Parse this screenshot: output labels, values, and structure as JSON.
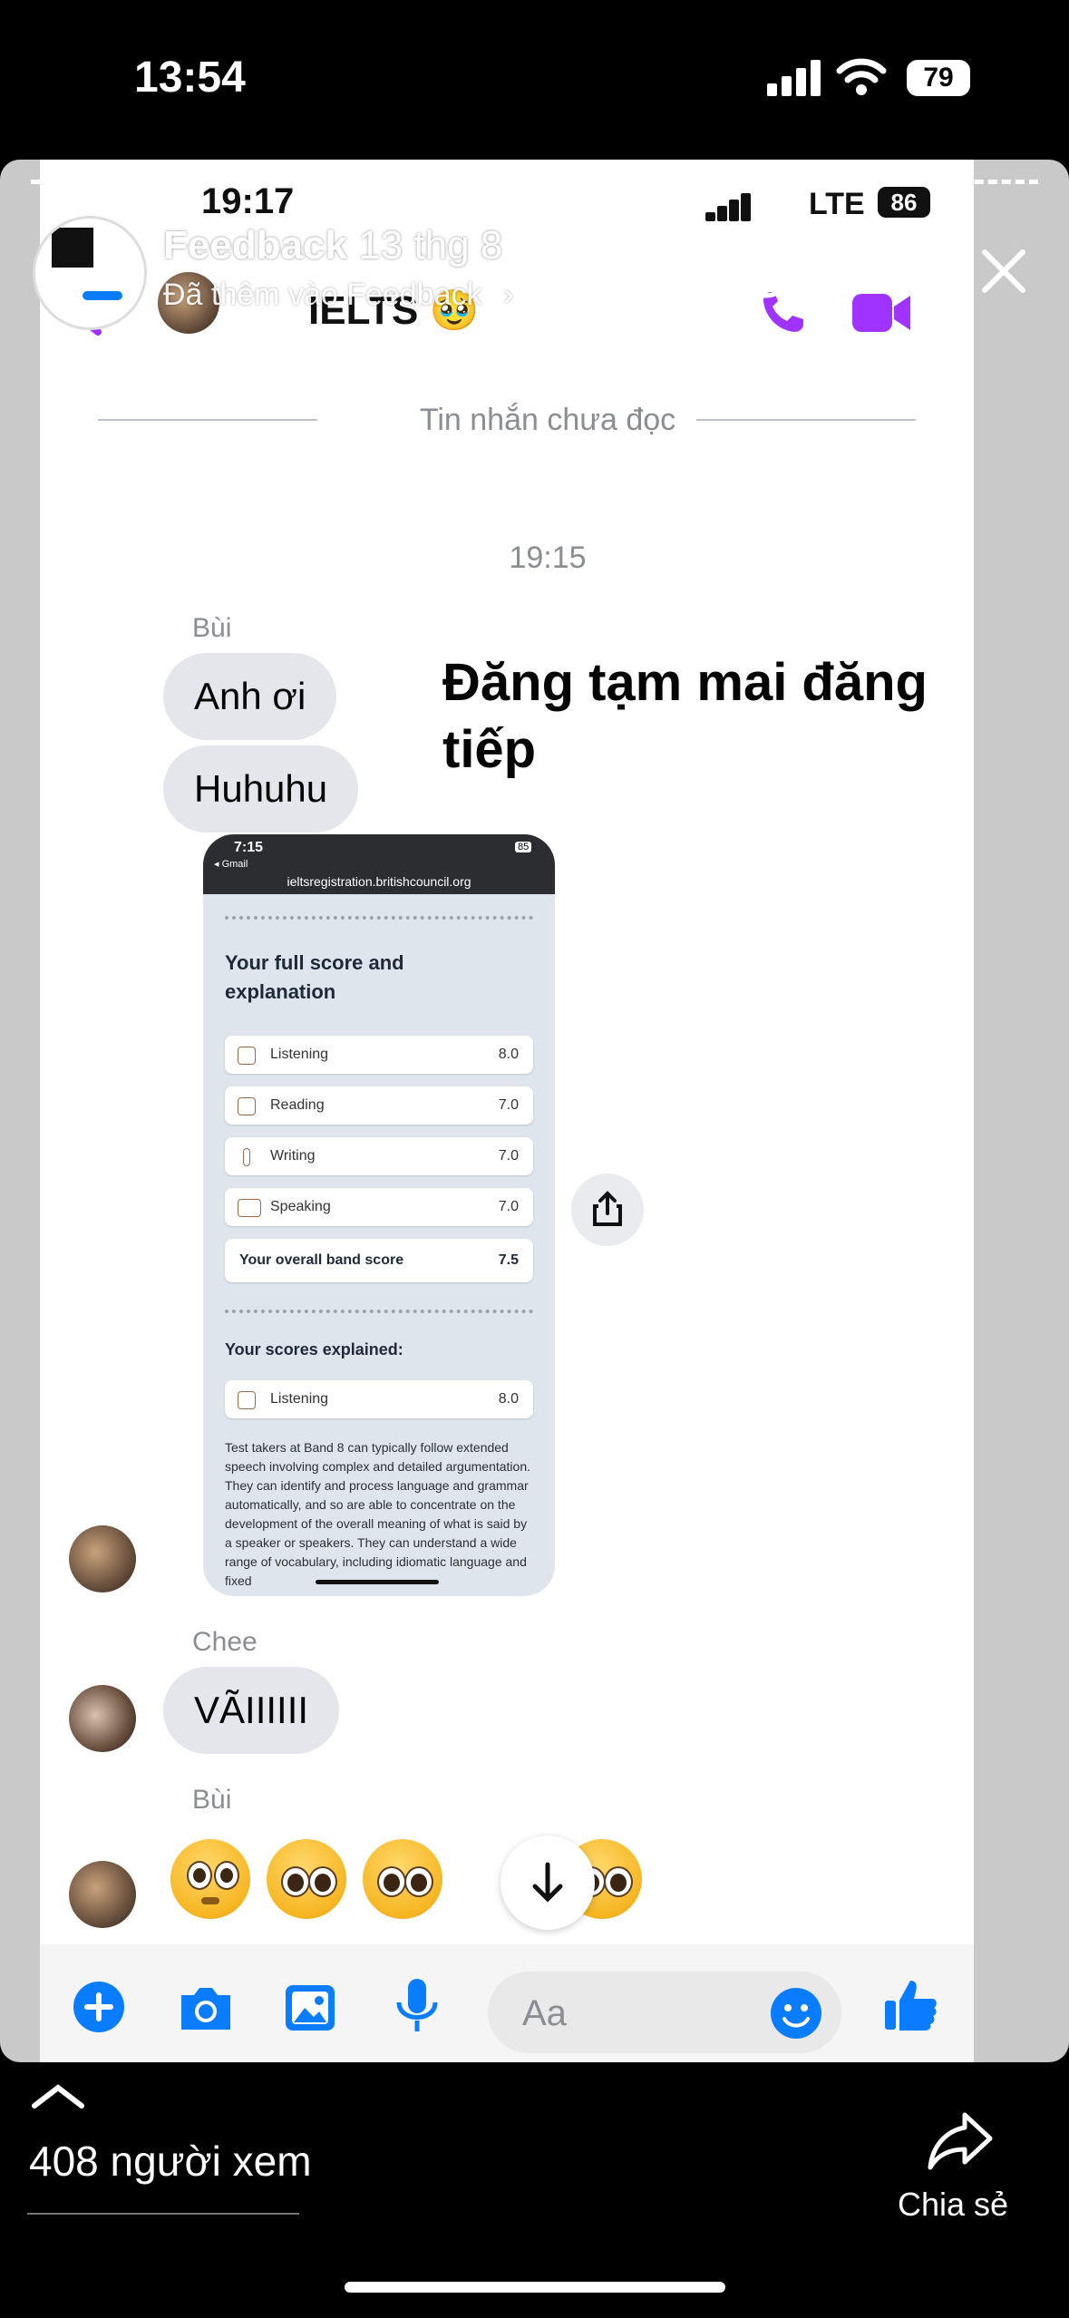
{
  "device": {
    "time": "13:54",
    "battery": "79"
  },
  "story": {
    "title": "Feedback",
    "date": "13 thg 8",
    "subtitle": "Đã thêm vào Feedback",
    "views": "408 người xem",
    "share_label": "Chia sẻ"
  },
  "inner_status": {
    "time": "19:17",
    "network": "LTE",
    "battery": "86"
  },
  "chat": {
    "name": "IELTS 🥹",
    "unread_divider": "Tin nhắn chưa đọc",
    "timestamp": "19:15",
    "messages": [
      {
        "sender": "Bùi",
        "texts": [
          "Anh ơi",
          "Huhuhu"
        ]
      },
      {
        "sender": "Chee",
        "texts": [
          "VÃIIIIII"
        ]
      },
      {
        "sender": "Bùi",
        "texts": []
      }
    ],
    "composer_placeholder": "Aa"
  },
  "overlay_text": "Đăng tạm mai đăng tiếp",
  "screenshot": {
    "time": "7:15",
    "back": "◂ Gmail",
    "battery": "85",
    "url": "ieltsregistration.britishcouncil.org",
    "heading": "Your full score and explanation",
    "scores": [
      {
        "label": "Listening",
        "value": "8.0"
      },
      {
        "label": "Reading",
        "value": "7.0"
      },
      {
        "label": "Writing",
        "value": "7.0"
      },
      {
        "label": "Speaking",
        "value": "7.0"
      }
    ],
    "overall_label": "Your overall band score",
    "overall_value": "7.5",
    "explained_heading": "Your scores explained:",
    "explained_row": {
      "label": "Listening",
      "value": "8.0"
    },
    "paragraph": "Test takers at Band 8 can typically follow extended speech involving complex and detailed argumentation. They can identify and process language and grammar automatically, and so are able to concentrate on the development of the overall meaning of what is said by a speaker or speakers. They can understand a wide range of vocabulary, including idiomatic language and fixed"
  },
  "colors": {
    "messenger_blue": "#0a7cff",
    "messenger_purple": "#a033ff",
    "bubble_gray": "#e4e6eb"
  }
}
